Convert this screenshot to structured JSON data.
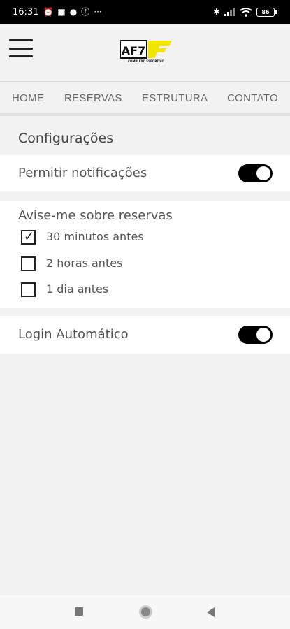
{
  "status_bar": {
    "time": "16:31",
    "battery": "86"
  },
  "header": {
    "logo_text": "AF7",
    "logo_subtext": "COMPLEXO ESPORTIVO"
  },
  "nav": {
    "tabs": [
      {
        "label": "HOME"
      },
      {
        "label": "RESERVAS"
      },
      {
        "label": "ESTRUTURA"
      },
      {
        "label": "CONTATO"
      }
    ]
  },
  "settings": {
    "title": "Configurações",
    "notifications": {
      "label": "Permitir notificações",
      "enabled": true
    },
    "reminders": {
      "label": "Avise-me sobre reservas",
      "options": [
        {
          "label": "30 minutos antes",
          "checked": true
        },
        {
          "label": "2 horas antes",
          "checked": false
        },
        {
          "label": "1 dia antes",
          "checked": false
        }
      ]
    },
    "auto_login": {
      "label": "Login Automático",
      "enabled": true
    }
  },
  "colors": {
    "accent_yellow": "#f2e600",
    "toggle_on": "#000000",
    "background": "#f2f2f2"
  }
}
